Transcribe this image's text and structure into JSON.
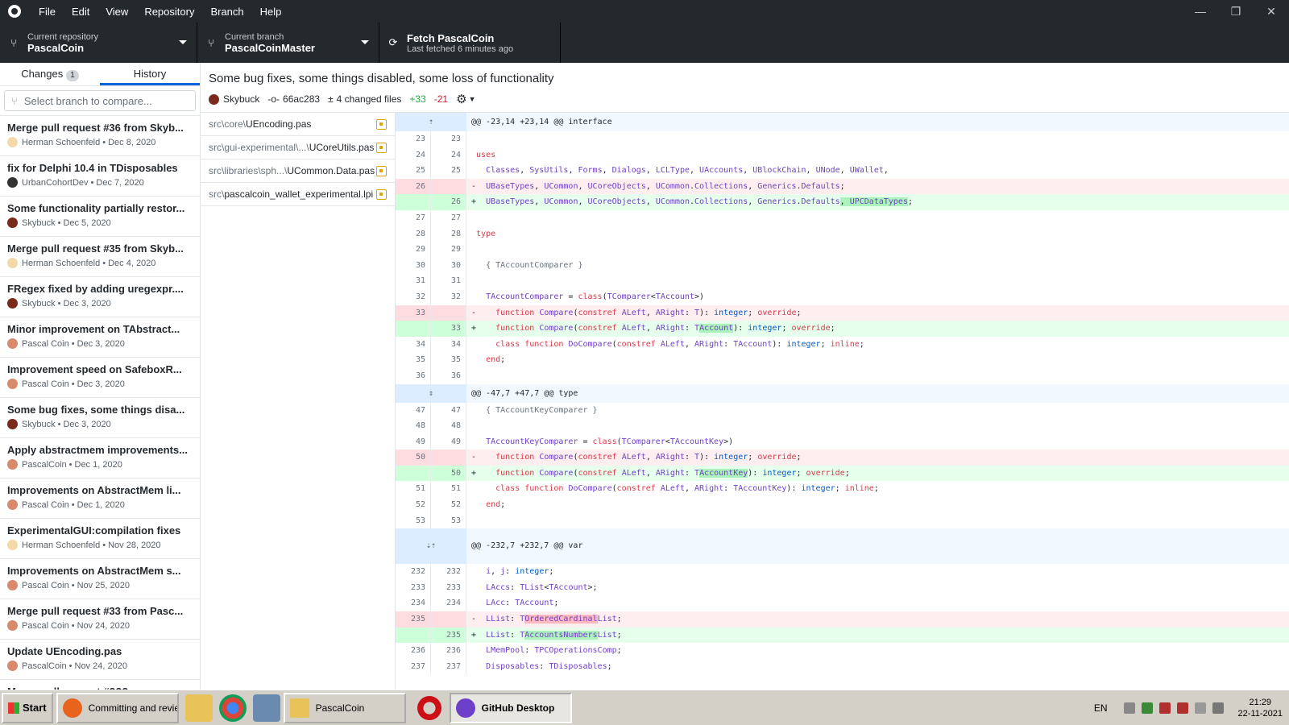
{
  "menu": [
    "File",
    "Edit",
    "View",
    "Repository",
    "Branch",
    "Help"
  ],
  "window_controls": [
    "—",
    "❐",
    "✕"
  ],
  "toolbar": {
    "repo": {
      "label": "Current repository",
      "value": "PascalCoin"
    },
    "branch": {
      "label": "Current branch",
      "value": "PascalCoinMaster"
    },
    "fetch": {
      "label": "Fetch PascalCoin",
      "sub": "Last fetched 6 minutes ago"
    }
  },
  "sidebar": {
    "tabs": {
      "changes": "Changes",
      "changes_count": "1",
      "history": "History"
    },
    "branch_placeholder": "Select branch to compare...",
    "commits": [
      {
        "title": "Merge pull request #36 from Skyb...",
        "author": "Herman Schoenfeld",
        "date": "Dec 8, 2020",
        "avatar": "#f4d9a8"
      },
      {
        "title": "fix for Delphi 10.4 in TDisposables",
        "author": "UrbanCohortDev",
        "date": "Dec 7, 2020",
        "avatar": "#333333"
      },
      {
        "title": "Some functionality partially restor...",
        "author": "Skybuck",
        "date": "Dec 5, 2020",
        "avatar": "#7a2a1a"
      },
      {
        "title": "Merge pull request #35 from Skyb...",
        "author": "Herman Schoenfeld",
        "date": "Dec 4, 2020",
        "avatar": "#f4d9a8"
      },
      {
        "title": "FRegex fixed by adding uregexpr....",
        "author": "Skybuck",
        "date": "Dec 3, 2020",
        "avatar": "#7a2a1a"
      },
      {
        "title": "Minor improvement on TAbstract...",
        "author": "Pascal Coin",
        "date": "Dec 3, 2020",
        "avatar": "#d98a6a"
      },
      {
        "title": "Improvement speed on SafeboxR...",
        "author": "Pascal Coin",
        "date": "Dec 3, 2020",
        "avatar": "#d98a6a"
      },
      {
        "title": "Some bug fixes, some things disa...",
        "author": "Skybuck",
        "date": "Dec 3, 2020",
        "avatar": "#7a2a1a"
      },
      {
        "title": "Apply abstractmem improvements...",
        "author": "PascalCoin",
        "date": "Dec 1, 2020",
        "avatar": "#d98a6a"
      },
      {
        "title": "Improvements on AbstractMem li...",
        "author": "Pascal Coin",
        "date": "Dec 1, 2020",
        "avatar": "#d98a6a"
      },
      {
        "title": "ExperimentalGUI:compilation fixes",
        "author": "Herman Schoenfeld",
        "date": "Nov 28, 2020",
        "avatar": "#f4d9a8"
      },
      {
        "title": "Improvements on AbstractMem s...",
        "author": "Pascal Coin",
        "date": "Nov 25, 2020",
        "avatar": "#d98a6a"
      },
      {
        "title": "Merge pull request #33 from Pasc...",
        "author": "Pascal Coin",
        "date": "Nov 24, 2020",
        "avatar": "#d98a6a"
      },
      {
        "title": "Update UEncoding.pas",
        "author": "PascalCoin",
        "date": "Nov 24, 2020",
        "avatar": "#d98a6a"
      },
      {
        "title": "Merge pull request #???",
        "author": "",
        "date": "",
        "avatar": "#d98a6a"
      }
    ]
  },
  "summary": {
    "title": "Some bug fixes, some things disabled, some loss of functionality",
    "author": "Skybuck",
    "sha": "66ac283",
    "files_changed": "4 changed files",
    "additions": "+33",
    "deletions": "-21"
  },
  "files": [
    {
      "dir": "src\\core\\",
      "name": "UEncoding.pas"
    },
    {
      "dir": "src\\gui-experimental\\...\\",
      "name": "UCoreUtils.pas"
    },
    {
      "dir": "src\\libraries\\sph...\\",
      "name": "UCommon.Data.pas"
    },
    {
      "dir": "src\\",
      "name": "pascalcoin_wallet_experimental.lpi"
    }
  ],
  "diff": {
    "hunks": [
      "@@ -23,14 +23,14 @@ interface",
      "@@ -47,7 +47,7 @@ type",
      "@@ -232,7 +232,7 @@ var"
    ],
    "lines": [
      {
        "type": "hunk",
        "h": 0
      },
      {
        "type": "ctx",
        "o": "23",
        "n": "23",
        "html": " "
      },
      {
        "type": "ctx",
        "o": "24",
        "n": "24",
        "html": " <span class=\"kw\">uses</span>"
      },
      {
        "type": "ctx",
        "o": "25",
        "n": "25",
        "html": "   <span class=\"ty\">Classes</span>, <span class=\"ty\">SysUtils</span>, <span class=\"ty\">Forms</span>, <span class=\"ty\">Dialogs</span>, <span class=\"ty\">LCLType</span>, <span class=\"ty\">UAccounts</span>, <span class=\"ty\">UBlockChain</span>, <span class=\"ty\">UNode</span>, <span class=\"ty\">UWallet</span>,"
      },
      {
        "type": "del",
        "o": "26",
        "n": "",
        "html": "-  <span class=\"ty\">UBaseTypes</span>, <span class=\"ty\">UCommon</span>, <span class=\"ty\">UCoreObjects</span>, <span class=\"ty\">UCommon</span>.<span class=\"ty\">Collections</span>, <span class=\"ty\">Generics</span>.<span class=\"ty\">Defaults</span>;"
      },
      {
        "type": "add",
        "o": "",
        "n": "26",
        "html": "+  <span class=\"ty\">UBaseTypes</span>, <span class=\"ty\">UCommon</span>, <span class=\"ty\">UCoreObjects</span>, <span class=\"ty\">UCommon</span>.<span class=\"ty\">Collections</span>, <span class=\"ty\">Generics</span>.<span class=\"ty\">Defaults</span><span class=\"hl-add\">, <span class=\"ty\">UPCDataTypes</span></span>;"
      },
      {
        "type": "ctx",
        "o": "27",
        "n": "27",
        "html": " "
      },
      {
        "type": "ctx",
        "o": "28",
        "n": "28",
        "html": " <span class=\"kw\">type</span>"
      },
      {
        "type": "ctx",
        "o": "29",
        "n": "29",
        "html": " "
      },
      {
        "type": "ctx",
        "o": "30",
        "n": "30",
        "html": "   <span class=\"cm\">{ TAccountComparer }</span>"
      },
      {
        "type": "ctx",
        "o": "31",
        "n": "31",
        "html": " "
      },
      {
        "type": "ctx",
        "o": "32",
        "n": "32",
        "html": "   <span class=\"ty\">TAccountComparer</span> = <span class=\"kw\">class</span>(<span class=\"ty\">TComparer</span>&lt;<span class=\"ty\">TAccount</span>&gt;)"
      },
      {
        "type": "del",
        "o": "33",
        "n": "",
        "html": "-    <span class=\"kw\">function</span> <span class=\"ty\">Compare</span>(<span class=\"kw\">constref</span> <span class=\"ty\">ALeft</span>, <span class=\"ty\">ARight</span>: <span class=\"ty\">T</span>): <span class=\"id\">integer</span>; <span class=\"kw\">override</span>;"
      },
      {
        "type": "add",
        "o": "",
        "n": "33",
        "html": "+    <span class=\"kw\">function</span> <span class=\"ty\">Compare</span>(<span class=\"kw\">constref</span> <span class=\"ty\">ALeft</span>, <span class=\"ty\">ARight</span>: <span class=\"ty\">T<span class=\"hl-add\">Account</span></span>): <span class=\"id\">integer</span>; <span class=\"kw\">override</span>;"
      },
      {
        "type": "ctx",
        "o": "34",
        "n": "34",
        "html": "     <span class=\"kw\">class function</span> <span class=\"ty\">DoCompare</span>(<span class=\"kw\">constref</span> <span class=\"ty\">ALeft</span>, <span class=\"ty\">ARight</span>: <span class=\"ty\">TAccount</span>): <span class=\"id\">integer</span>; <span class=\"kw\">inline</span>;"
      },
      {
        "type": "ctx",
        "o": "35",
        "n": "35",
        "html": "   <span class=\"kw\">end</span>;"
      },
      {
        "type": "ctx",
        "o": "36",
        "n": "36",
        "html": " "
      },
      {
        "type": "hunk",
        "h": 1
      },
      {
        "type": "ctx",
        "o": "47",
        "n": "47",
        "html": "   <span class=\"cm\">{ TAccountKeyComparer }</span>"
      },
      {
        "type": "ctx",
        "o": "48",
        "n": "48",
        "html": " "
      },
      {
        "type": "ctx",
        "o": "49",
        "n": "49",
        "html": "   <span class=\"ty\">TAccountKeyComparer</span> = <span class=\"kw\">class</span>(<span class=\"ty\">TComparer</span>&lt;<span class=\"ty\">TAccountKey</span>&gt;)"
      },
      {
        "type": "del",
        "o": "50",
        "n": "",
        "html": "-    <span class=\"kw\">function</span> <span class=\"ty\">Compare</span>(<span class=\"kw\">constref</span> <span class=\"ty\">ALeft</span>, <span class=\"ty\">ARight</span>: <span class=\"ty\">T</span>): <span class=\"id\">integer</span>; <span class=\"kw\">override</span>;"
      },
      {
        "type": "add",
        "o": "",
        "n": "50",
        "html": "+    <span class=\"kw\">function</span> <span class=\"ty\">Compare</span>(<span class=\"kw\">constref</span> <span class=\"ty\">ALeft</span>, <span class=\"ty\">ARight</span>: <span class=\"ty\">T<span class=\"hl-add\">AccountKey</span></span>): <span class=\"id\">integer</span>; <span class=\"kw\">override</span>;"
      },
      {
        "type": "ctx",
        "o": "51",
        "n": "51",
        "html": "     <span class=\"kw\">class function</span> <span class=\"ty\">DoCompare</span>(<span class=\"kw\">constref</span> <span class=\"ty\">ALeft</span>, <span class=\"ty\">ARight</span>: <span class=\"ty\">TAccountKey</span>): <span class=\"id\">integer</span>; <span class=\"kw\">inline</span>;"
      },
      {
        "type": "ctx",
        "o": "52",
        "n": "52",
        "html": "   <span class=\"kw\">end</span>;"
      },
      {
        "type": "ctx",
        "o": "53",
        "n": "53",
        "html": " "
      },
      {
        "type": "hunk2",
        "h": 2
      },
      {
        "type": "ctx",
        "o": "232",
        "n": "232",
        "html": "   <span class=\"ty\">i</span>, <span class=\"ty\">j</span>: <span class=\"id\">integer</span>;"
      },
      {
        "type": "ctx",
        "o": "233",
        "n": "233",
        "html": "   <span class=\"ty\">LAccs</span>: <span class=\"ty\">TList</span>&lt;<span class=\"ty\">TAccount</span>&gt;;"
      },
      {
        "type": "ctx",
        "o": "234",
        "n": "234",
        "html": "   <span class=\"ty\">LAcc</span>: <span class=\"ty\">TAccount</span>;"
      },
      {
        "type": "del",
        "o": "235",
        "n": "",
        "html": "-  <span class=\"ty\">LList</span>: <span class=\"ty\">T<span class=\"hl-del\">OrderedCardinal</span>List</span>;"
      },
      {
        "type": "add",
        "o": "",
        "n": "235",
        "html": "+  <span class=\"ty\">LList</span>: <span class=\"ty\">T<span class=\"hl-add\">AccountsNumbers</span>List</span>;"
      },
      {
        "type": "ctx",
        "o": "236",
        "n": "236",
        "html": "   <span class=\"ty\">LMemPool</span>: <span class=\"ty\">TPCOperationsComp</span>;"
      },
      {
        "type": "ctx",
        "o": "237",
        "n": "237",
        "html": "   <span class=\"ty\">Disposables</span>: <span class=\"ty\">TDisposables</span>;"
      }
    ]
  },
  "taskbar": {
    "start": "Start",
    "tasks": [
      {
        "label": "Committing and revie...",
        "color": "#e8631c",
        "active": false
      },
      {
        "label": "PascalCoin",
        "color": "#e8c35a",
        "active": false
      },
      {
        "label": "GitHub Desktop",
        "color": "#6e40c9",
        "active": true
      }
    ],
    "lang": "EN",
    "time": "21:29",
    "date": "22-11-2021"
  }
}
